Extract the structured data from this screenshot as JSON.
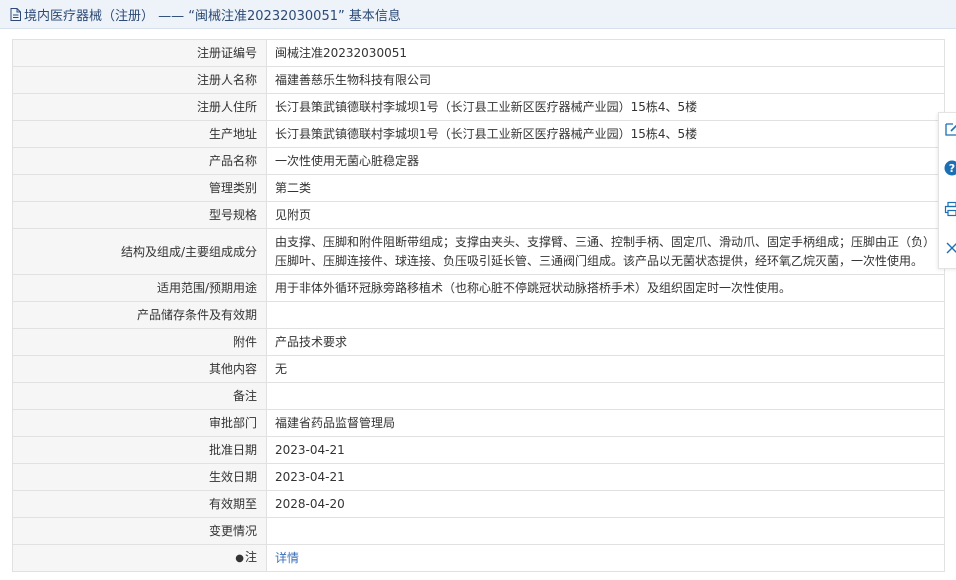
{
  "header": {
    "title": "境内医疗器械（注册） —— “闽械注准20232030051” 基本信息"
  },
  "rows": [
    {
      "label": "注册证编号",
      "value": "闽械注准20232030051"
    },
    {
      "label": "注册人名称",
      "value": "福建善慈乐生物科技有限公司"
    },
    {
      "label": "注册人住所",
      "value": "长汀县策武镇德联村李城坝1号（长汀县工业新区医疗器械产业园）15栋4、5楼"
    },
    {
      "label": "生产地址",
      "value": "长汀县策武镇德联村李城坝1号（长汀县工业新区医疗器械产业园）15栋4、5楼"
    },
    {
      "label": "产品名称",
      "value": "一次性使用无菌心脏稳定器"
    },
    {
      "label": "管理类别",
      "value": "第二类"
    },
    {
      "label": "型号规格",
      "value": "见附页"
    },
    {
      "label": "结构及组成/主要组成成分",
      "value": "由支撑、压脚和附件阻断带组成；支撑由夹头、支撑臂、三通、控制手柄、固定爪、滑动爪、固定手柄组成；压脚由正（负）压脚叶、压脚连接件、球连接、负压吸引延长管、三通阀门组成。该产品以无菌状态提供，经环氧乙烷灭菌，一次性使用。"
    },
    {
      "label": "适用范围/预期用途",
      "value": "用于非体外循环冠脉旁路移植术（也称心脏不停跳冠状动脉搭桥手术）及组织固定时一次性使用。"
    },
    {
      "label": "产品储存条件及有效期",
      "value": ""
    },
    {
      "label": "附件",
      "value": "产品技术要求"
    },
    {
      "label": "其他内容",
      "value": "无"
    },
    {
      "label": "备注",
      "value": ""
    },
    {
      "label": "审批部门",
      "value": "福建省药品监督管理局"
    },
    {
      "label": "批准日期",
      "value": "2023-04-21"
    },
    {
      "label": "生效日期",
      "value": "2023-04-21"
    },
    {
      "label": "有效期至",
      "value": "2028-04-20"
    },
    {
      "label": "变更情况",
      "value": ""
    },
    {
      "label": "注",
      "value": "详情"
    }
  ],
  "side_toolbar": [
    "edit-icon",
    "help-icon",
    "print-icon",
    "close-icon"
  ],
  "colors": {
    "title_bar_bg": "#eef3fa",
    "title_text": "#2c4a75",
    "label_bg": "#f6f6f6",
    "border": "#e1e1e1",
    "link": "#3a70b8",
    "toolbar_icon": "#1a6fb5"
  }
}
